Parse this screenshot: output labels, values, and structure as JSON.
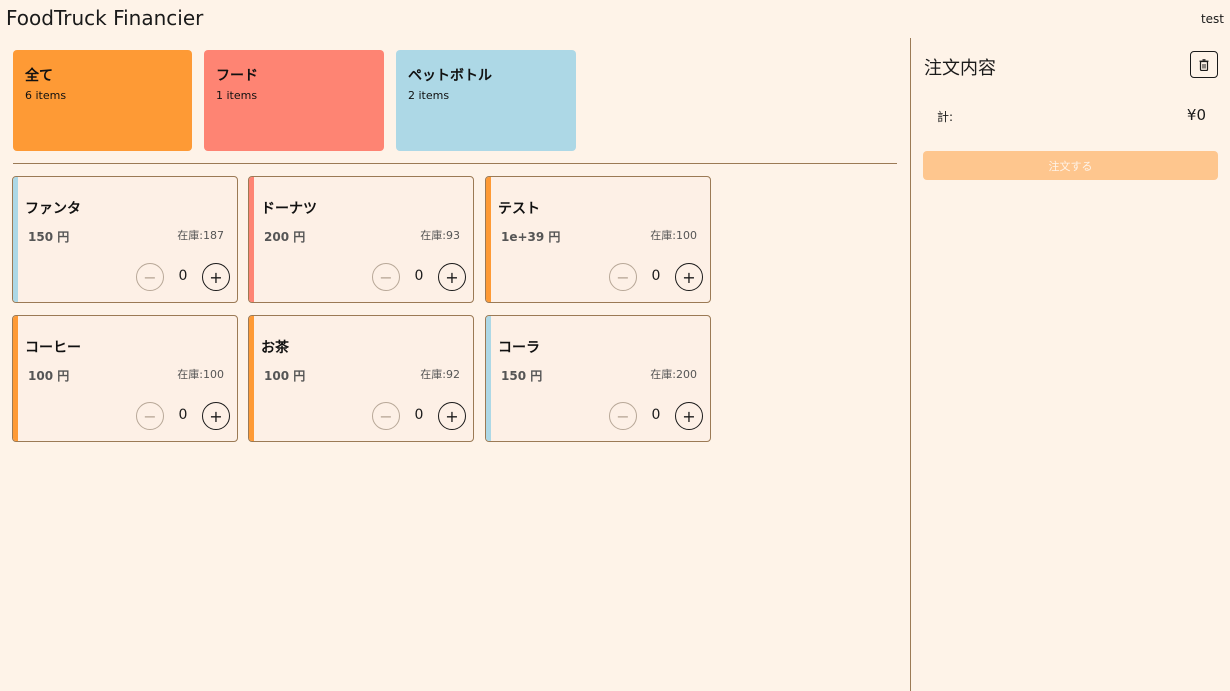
{
  "header": {
    "title": "FoodTruck Financier",
    "user": "test"
  },
  "categories": [
    {
      "name": "全て",
      "count": "6 items",
      "color": "#fe9a35"
    },
    {
      "name": "フード",
      "count": "1 items",
      "color": "#fe8473"
    },
    {
      "name": "ペットボトル",
      "count": "2 items",
      "color": "#add8e6"
    }
  ],
  "products": [
    {
      "name": "ファンタ",
      "price": "150 円",
      "stock": "在庫:187",
      "qty": "0",
      "accent": "#add8e6"
    },
    {
      "name": "ドーナツ",
      "price": "200 円",
      "stock": "在庫:93",
      "qty": "0",
      "accent": "#fe8473"
    },
    {
      "name": "テスト",
      "price": "1e+39 円",
      "stock": "在庫:100",
      "qty": "0",
      "accent": "#fe9a35"
    },
    {
      "name": "コーヒー",
      "price": "100 円",
      "stock": "在庫:100",
      "qty": "0",
      "accent": "#fe9a35"
    },
    {
      "name": "お茶",
      "price": "100 円",
      "stock": "在庫:92",
      "qty": "0",
      "accent": "#fe9a35"
    },
    {
      "name": "コーラ",
      "price": "150 円",
      "stock": "在庫:200",
      "qty": "0",
      "accent": "#add8e6"
    }
  ],
  "qty_controls": {
    "minus": "−",
    "plus": "+"
  },
  "order": {
    "title": "注文内容",
    "total_label": "計:",
    "total_value": "¥0",
    "submit_label": "注文する",
    "trash_icon": "trash-icon"
  }
}
